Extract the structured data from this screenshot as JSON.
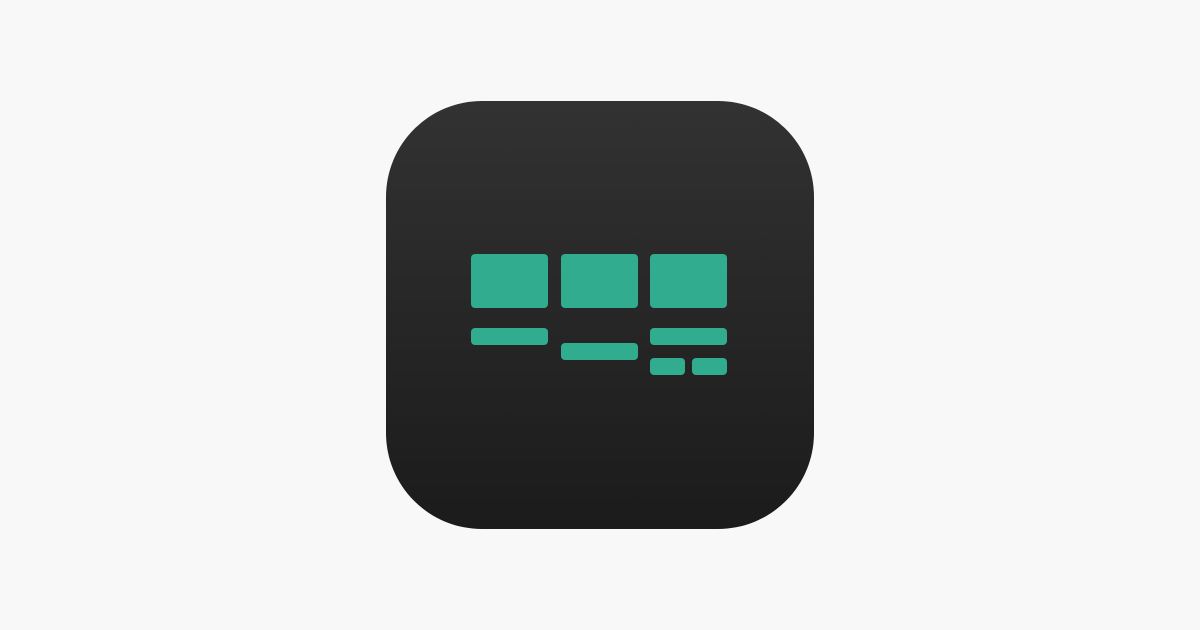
{
  "colors": {
    "background": "#f8f8f8",
    "icon_top": "#323232",
    "icon_bottom": "#1b1b1b",
    "accent": "#31ac8f"
  },
  "icon": {
    "semantic": "grid-layout-icon"
  }
}
